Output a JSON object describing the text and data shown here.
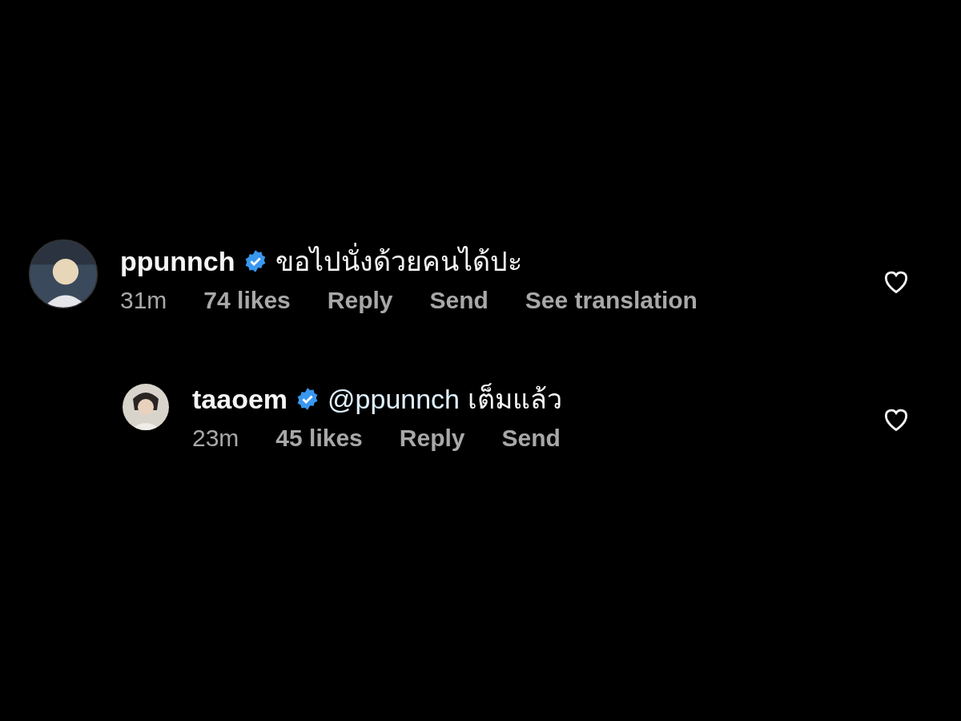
{
  "comments": [
    {
      "username": "ppunnch",
      "verified": true,
      "text": "ขอไปนั่งด้วยคนได้ปะ",
      "time": "31m",
      "likes": "74 likes",
      "actions": [
        "Reply",
        "Send",
        "See translation"
      ],
      "liked": false,
      "replies": [
        {
          "username": "taaoem",
          "verified": true,
          "mention": "@ppunnch",
          "text": "เต็มแล้ว",
          "time": "23m",
          "likes": "45 likes",
          "actions": [
            "Reply",
            "Send"
          ],
          "liked": false
        }
      ]
    }
  ]
}
